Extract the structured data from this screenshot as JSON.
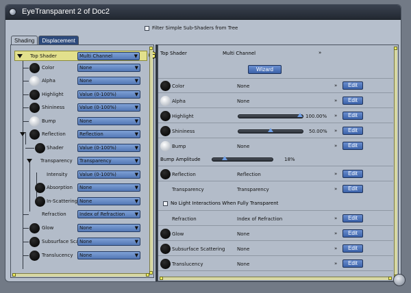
{
  "window": {
    "title": "EyeTransparent 2 of Doc2"
  },
  "filter": {
    "label": "Filter Simple Sub-Shaders from Tree"
  },
  "tabs": [
    "Shading",
    "Displacement"
  ],
  "left": {
    "top_shader": {
      "label": "Top Shader",
      "value": "Multi Channel"
    },
    "rows": [
      {
        "label": "Color",
        "value": "None"
      },
      {
        "label": "Alpha",
        "value": "None"
      },
      {
        "label": "Highlight",
        "value": "Value (0-100%)"
      },
      {
        "label": "Shininess",
        "value": "Value (0-100%)"
      },
      {
        "label": "Bump",
        "value": "None"
      },
      {
        "label": "Reflection",
        "value": "Reflection"
      },
      {
        "label": "Shader",
        "value": "Value (0-100%)"
      },
      {
        "label": "Transparency",
        "value": "Transparency"
      },
      {
        "label": "Intensity",
        "value": "Value (0-100%)"
      },
      {
        "label": "Absorption",
        "value": "None"
      },
      {
        "label": "In-Scattering",
        "value": "None"
      },
      {
        "label": "Refraction",
        "value": "Index of Refraction"
      },
      {
        "label": "Glow",
        "value": "None"
      },
      {
        "label": "Subsurface Scat",
        "value": "None"
      },
      {
        "label": "Translucency",
        "value": "None"
      }
    ]
  },
  "right": {
    "top_shader": {
      "label": "Top Shader",
      "value": "Multi Channel"
    },
    "wizard": "Wizard",
    "edit": "Edit",
    "rows": {
      "color": {
        "label": "Color",
        "value": "None"
      },
      "alpha": {
        "label": "Alpha",
        "value": "None"
      },
      "highlight": {
        "label": "Highlight",
        "value": "100.00%",
        "level": 1.0
      },
      "shininess": {
        "label": "Shininess",
        "value": "50.00%",
        "level": 0.5
      },
      "bump": {
        "label": "Bump",
        "value": "None"
      },
      "bump_amp": {
        "label": "Bump Amplitude",
        "value": "18%",
        "level": 0.18
      },
      "reflection": {
        "label": "Reflection",
        "value": "Reflection"
      },
      "transparency": {
        "label": "Transparency",
        "value": "Transparency"
      },
      "no_light": {
        "label": "No Light Interactions When Fully Transparent"
      },
      "refraction": {
        "label": "Refraction",
        "value": "Index of Refraction"
      },
      "glow": {
        "label": "Glow",
        "value": "None"
      },
      "subsurface": {
        "label": "Subsurface Scattering",
        "value": "None"
      },
      "translucency": {
        "label": "Translucency",
        "value": "None"
      }
    }
  }
}
